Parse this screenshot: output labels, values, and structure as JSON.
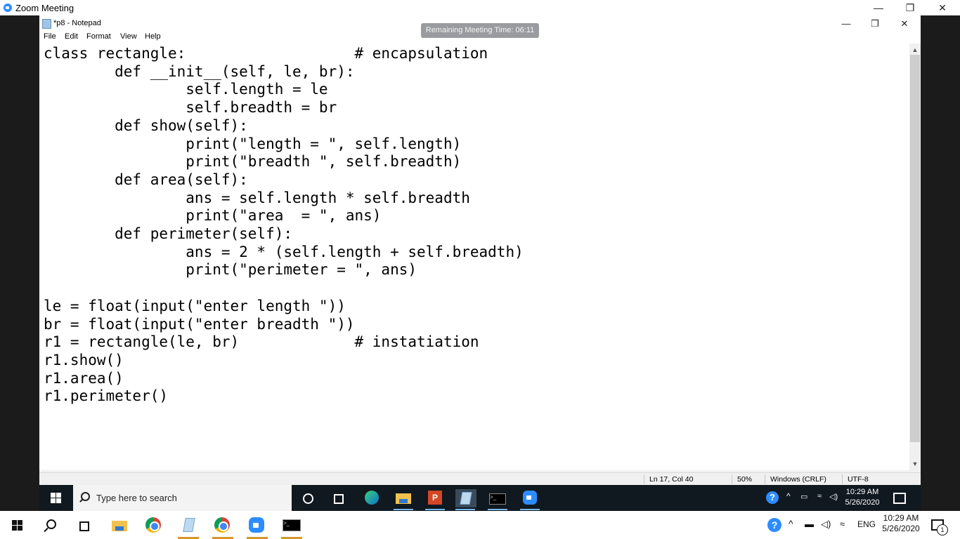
{
  "zoom": {
    "title": "Zoom Meeting",
    "minimize": "—",
    "restore": "❐",
    "close": "✕",
    "meeting_time": "Remaining Meeting Time: 06:11"
  },
  "notepad": {
    "title": "*p8 - Notepad",
    "minimize": "—",
    "restore": "❐",
    "close": "✕",
    "menu": [
      "File",
      "Edit",
      "Format",
      "View",
      "Help"
    ],
    "code": "class rectangle:                   # encapsulation\n        def __init__(self, le, br):\n                self.length = le\n                self.breadth = br\n        def show(self):\n                print(\"length = \", self.length)\n                print(\"breadth \", self.breadth)\n        def area(self):\n                ans = self.length * self.breadth\n                print(\"area  = \", ans)\n        def perimeter(self):\n                ans = 2 * (self.length + self.breadth)\n                print(\"perimeter = \", ans)\n\nle = float(input(\"enter length \"))\nbr = float(input(\"enter breadth \"))\nr1 = rectangle(le, br)             # instatiation\nr1.show()\nr1.area()\nr1.perimeter()",
    "status": {
      "position": "Ln 17, Col 40",
      "zoom": "50%",
      "line_ending": "Windows (CRLF)",
      "encoding": "UTF-8"
    }
  },
  "inner_taskbar": {
    "search_placeholder": "Type here to search",
    "time": "10:29 AM",
    "date": "5/26/2020",
    "icons": [
      "windows-start-icon",
      "search-icon",
      "cortana-icon",
      "task-view-icon",
      "edge-icon",
      "file-explorer-icon",
      "powerpoint-icon",
      "notepad-icon",
      "cmd-icon",
      "zoom-icon"
    ]
  },
  "outer_taskbar": {
    "time": "10:29 AM",
    "date": "5/26/2020",
    "language": "ENG",
    "notification_count": "1",
    "icons": [
      "windows-start-icon",
      "search-icon",
      "task-view-icon",
      "file-explorer-icon",
      "chrome-icon",
      "notepad-icon",
      "chrome-icon",
      "zoom-icon",
      "cmd-icon"
    ]
  },
  "colors": {
    "zoom_blue": "#2d8cff",
    "taskbar_dark": "#101820",
    "accent_underline": "#76b9ed"
  }
}
